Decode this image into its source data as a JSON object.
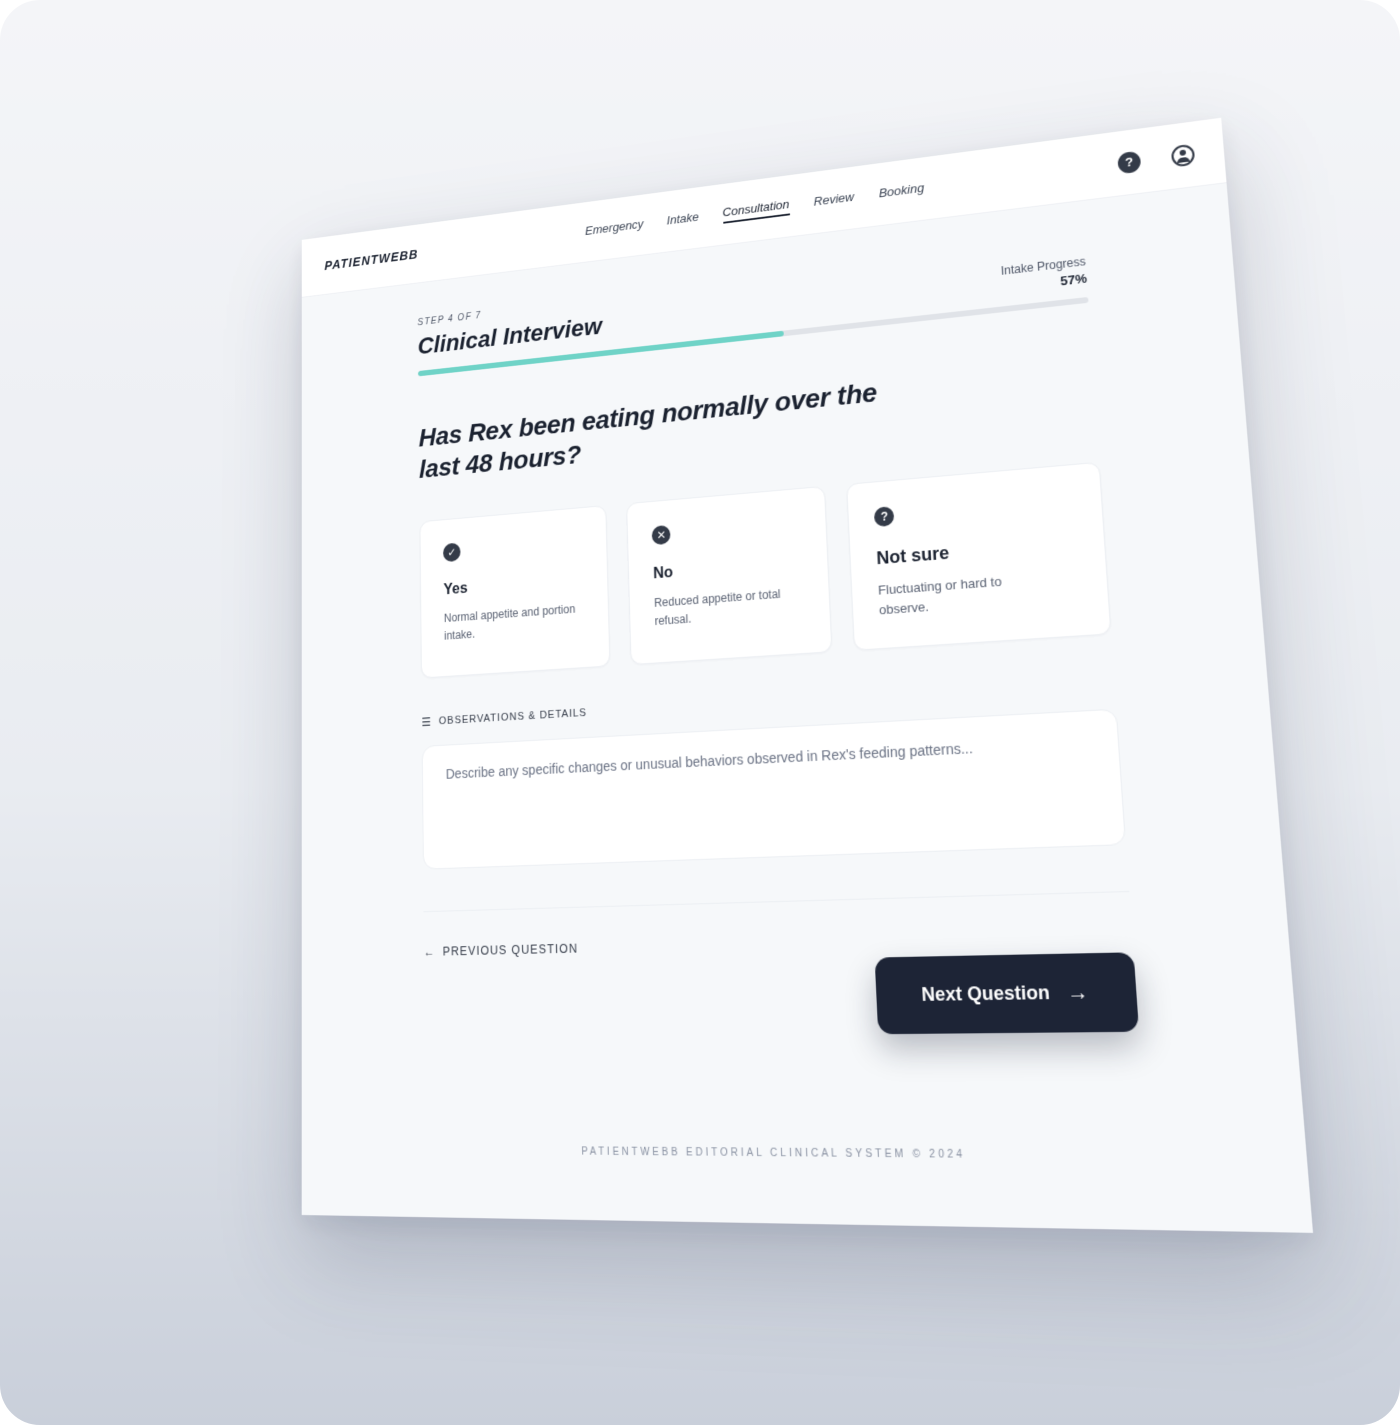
{
  "app": {
    "brand": "PATIENTWEBB"
  },
  "nav": {
    "items": [
      {
        "label": "Emergency"
      },
      {
        "label": "Intake"
      },
      {
        "label": "Consultation"
      },
      {
        "label": "Review"
      },
      {
        "label": "Booking"
      }
    ],
    "active": "Consultation"
  },
  "header_tools": {
    "help_icon": "help-icon",
    "account_icon": "account-icon"
  },
  "step": {
    "label": "STEP 4 OF 7",
    "title": "Clinical Interview",
    "progress_label": "Intake Progress",
    "progress_value": "57%",
    "progress_fraction": 0.57,
    "progress_color": "#6fd3c7"
  },
  "question": {
    "text": "Has Rex been eating normally over the last 48 hours?"
  },
  "options": [
    {
      "icon": "check-circle-icon",
      "glyph": "✓",
      "title": "Yes",
      "desc": "Normal appetite and portion intake."
    },
    {
      "icon": "x-circle-icon",
      "glyph": "✕",
      "title": "No",
      "desc": "Reduced appetite or total refusal."
    },
    {
      "icon": "question-circle-icon",
      "glyph": "?",
      "title": "Not sure",
      "desc": "Fluctuating or hard to observe."
    }
  ],
  "observations": {
    "label": "OBSERVATIONS & DETAILS",
    "placeholder": "Describe any specific changes or unusual behaviors observed in Rex's feeding patterns...",
    "value": ""
  },
  "actions": {
    "previous_label": "PREVIOUS QUESTION",
    "next_label": "Next Question",
    "button_color": "#1d2436"
  },
  "footer": {
    "text": "PATIENTWEBB EDITORIAL CLINICAL SYSTEM © 2024"
  }
}
